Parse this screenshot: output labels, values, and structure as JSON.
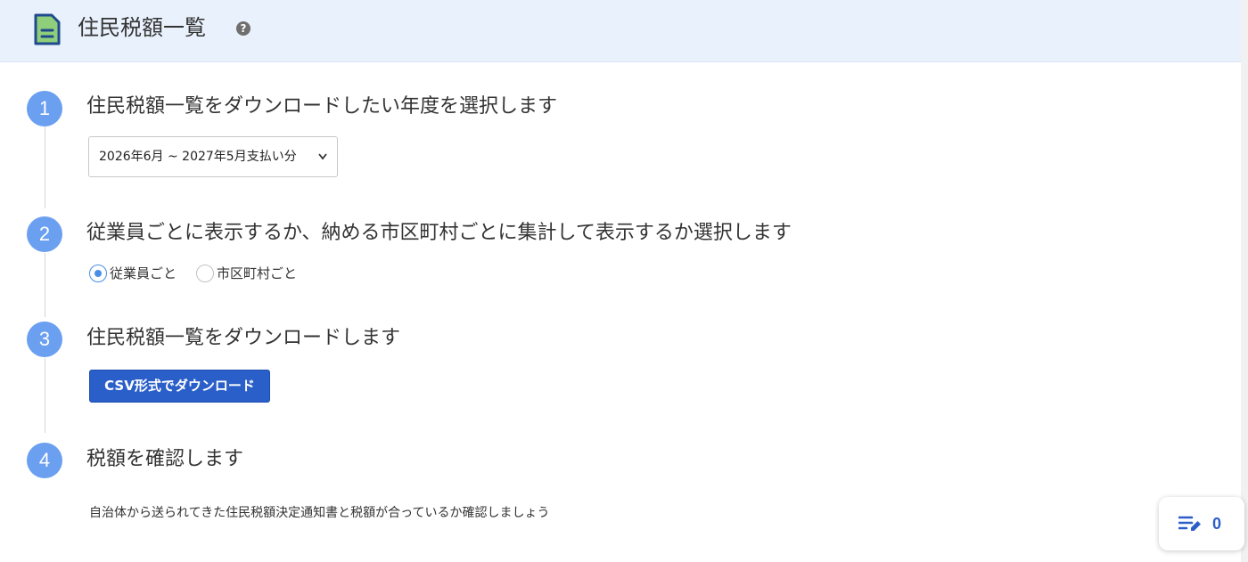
{
  "header": {
    "title": "住民税額一覧",
    "help_icon": "?"
  },
  "steps": [
    {
      "number": "1",
      "title": "住民税額一覧をダウンロードしたい年度を選択します"
    },
    {
      "number": "2",
      "title": "従業員ごとに表示するか、納める市区町村ごとに集計して表示するか選択します"
    },
    {
      "number": "3",
      "title": "住民税額一覧をダウンロードします"
    },
    {
      "number": "4",
      "title": "税額を確認します"
    }
  ],
  "year_select": {
    "value": "2026年6月 ~ 2027年5月支払い分"
  },
  "display_mode": {
    "options": [
      {
        "label": "従業員ごと",
        "checked": true
      },
      {
        "label": "市区町村ごと",
        "checked": false
      }
    ]
  },
  "download": {
    "label": "CSV形式でダウンロード"
  },
  "step4": {
    "text": "自治体から送られてきた住民税額決定通知書と税額が合っているか確認しましょう"
  },
  "counter": {
    "value": "0",
    "icon": "edit-list-icon"
  },
  "colors": {
    "header_bg": "#e9f1fc",
    "step_circle": "#6b9ff0",
    "primary_button": "#2a5fc9",
    "radio_checked": "#4a8fe7",
    "doc_icon": "#8fce7a"
  }
}
